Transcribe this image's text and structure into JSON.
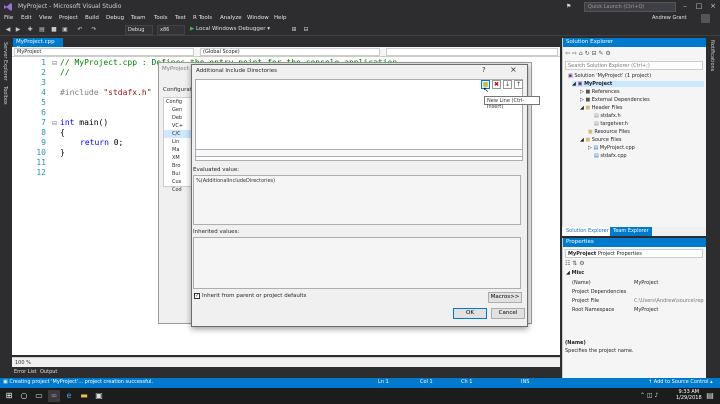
{
  "window": {
    "title": "MyProject - Microsoft Visual Studio",
    "quick_launch": "Quick Launch (Ctrl+Q)",
    "user": "Andrew Grant"
  },
  "menu": [
    "File",
    "Edit",
    "View",
    "Project",
    "Build",
    "Debug",
    "Team",
    "Tools",
    "Test",
    "R Tools",
    "Analyze",
    "Window",
    "Help"
  ],
  "toolbar": {
    "config": "Debug",
    "platform": "x86",
    "run_label": "Local Windows Debugger"
  },
  "side": {
    "server_explorer": "Server Explorer",
    "toolbox": "Toolbox",
    "notifications": "Notifications"
  },
  "editor": {
    "tab": "MyProject.cpp",
    "nav_left": "MyProject",
    "nav_mid": "(Global Scope)",
    "zoom": "100 %",
    "lines": [
      "1",
      "2",
      "3",
      "4",
      "5",
      "6",
      "7",
      "8",
      "9",
      "10",
      "11",
      "12"
    ]
  },
  "code": {
    "l1": "// MyProject.cpp : Defines the entry point for the console application.",
    "l2": "//",
    "l4_pp": "#include ",
    "l4_str": "\"stdafx.h\"",
    "l7_kw": "int",
    "l7_rest": " main()",
    "l8": "{",
    "l9_kw": "return",
    "l9_rest": " 0;",
    "l10": "}"
  },
  "bg_dialog": {
    "title": "MyProject P",
    "config_label": "Configurati",
    "tree": [
      "Config",
      "Gen",
      "Deb",
      "VC+",
      "C/C",
      "Lin",
      "Ma",
      "XM",
      "Bro",
      "Bui",
      "Cus",
      "Cod"
    ]
  },
  "dialog": {
    "title": "Additional Include Directories",
    "help": "?",
    "close": "×",
    "tooltip": "New Line (Ctrl-Insert)",
    "evaluated_label": "Evaluated value:",
    "evaluated_value": "%(AdditionalIncludeDirectories)",
    "inherited_label": "Inherited values:",
    "inherit_checkbox": "Inherit from parent or project defaults",
    "macros": "Macros>>",
    "ok": "OK",
    "cancel": "Cancel"
  },
  "solution_explorer": {
    "title": "Solution Explorer",
    "search": "Search Solution Explorer (Ctrl+;)",
    "items": [
      "Solution 'MyProject' (1 project)",
      "MyProject",
      "References",
      "External Dependencies",
      "Header Files",
      "stdafx.h",
      "targetver.h",
      "Resource Files",
      "Source Files",
      "MyProject.cpp",
      "stdafx.cpp"
    ],
    "tab1": "Solution Explorer",
    "tab2": "Team Explorer"
  },
  "properties": {
    "title": "Properties",
    "object": "MyProject",
    "object_type": "Project Properties",
    "category": "Misc",
    "rows": [
      {
        "name": "(Name)",
        "value": "MyProject"
      },
      {
        "name": "Project Dependencies",
        "value": ""
      },
      {
        "name": "Project File",
        "value": "C:\\Users\\Andrew\\source\\repos"
      },
      {
        "name": "Root Namespace",
        "value": "MyProject"
      }
    ],
    "desc_title": "(Name)",
    "desc_text": "Specifies the project name."
  },
  "bottom": {
    "tab1": "Error List",
    "tab2": "Output"
  },
  "status": {
    "message": "Creating project 'MyProject'... project creation successful.",
    "ln": "Ln 1",
    "col": "Col 1",
    "ch": "Ch 1",
    "ins": "INS",
    "source_control": "Add to Source Control"
  },
  "taskbar": {
    "time": "9:33 AM",
    "date": "1/29/2018"
  }
}
